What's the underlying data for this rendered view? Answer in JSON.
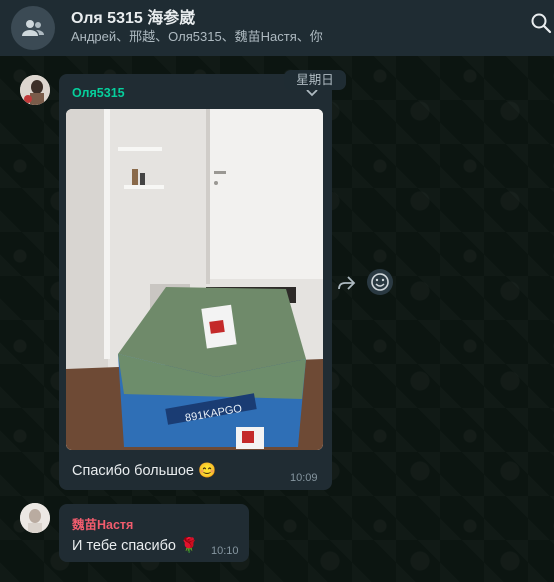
{
  "header": {
    "title": "Оля 5315 海参崴",
    "subtitle": "Андрей、邢越、Оля5315、魏苗Настя、你",
    "avatar_icon": "group-icon",
    "search_icon": "search-icon"
  },
  "day_divider": "星期日",
  "messages": [
    {
      "sender": "Оля5315",
      "sender_color": "#06cf9c",
      "image_alt": "Photo of a wrapped parcel in a hallway",
      "text": "Спасибо большое 😊",
      "time": "10:09"
    },
    {
      "sender": "魏苗Настя",
      "sender_color": "#f15c6d",
      "text": "И тебе спасибо 🌹",
      "time": "10:10"
    }
  ],
  "actions": {
    "forward_icon": "forward-icon",
    "react_icon": "emoji-icon"
  },
  "colors": {
    "header_bg": "#1f2c33",
    "bubble_bg": "#202c33",
    "chat_bg": "#0c1511"
  }
}
